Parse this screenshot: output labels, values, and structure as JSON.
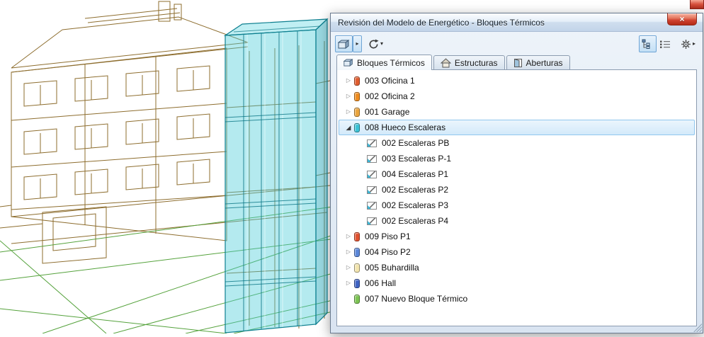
{
  "window": {
    "title": "Revisión del Modelo de Energético - Bloques Térmicos",
    "close_label": "×"
  },
  "glyphs": {
    "collapsed": "▷",
    "expanded": "◢",
    "dropdown": "▾",
    "flyout": "▸"
  },
  "toolbar": {
    "left_buttons": [
      "thermal-blocks-view",
      "flyout-arrow",
      "refresh"
    ],
    "right_buttons": [
      "tree-view",
      "list-view",
      "settings"
    ]
  },
  "tabs": [
    {
      "label": "Bloques Térmicos",
      "active": true
    },
    {
      "label": "Estructuras",
      "active": false
    },
    {
      "label": "Aberturas",
      "active": false
    }
  ],
  "colors": {
    "selection_fill": "#d2e9fa",
    "selection_border": "#90c6ee",
    "tower_highlight": "#4dccd8"
  },
  "tree": {
    "items": [
      {
        "label": "003 Oficina 1",
        "level": 0,
        "expandable": true,
        "expanded": false,
        "selected": false,
        "icon_color": "#e05c2e"
      },
      {
        "label": "002 Oficina 2",
        "level": 0,
        "expandable": true,
        "expanded": false,
        "selected": false,
        "icon_color": "#ee8b1e"
      },
      {
        "label": "001 Garage",
        "level": 0,
        "expandable": true,
        "expanded": false,
        "selected": false,
        "icon_color": "#eaa53e"
      },
      {
        "label": "008 Hueco Escaleras",
        "level": 0,
        "expandable": true,
        "expanded": true,
        "selected": true,
        "icon_color": "#3cc3d6"
      },
      {
        "label": "002 Escaleras PB",
        "level": 1,
        "expandable": false,
        "expanded": false,
        "selected": false
      },
      {
        "label": "003 Escaleras P-1",
        "level": 1,
        "expandable": false,
        "expanded": false,
        "selected": false
      },
      {
        "label": "004 Escaleras P1",
        "level": 1,
        "expandable": false,
        "expanded": false,
        "selected": false
      },
      {
        "label": "002 Escaleras P2",
        "level": 1,
        "expandable": false,
        "expanded": false,
        "selected": false
      },
      {
        "label": "002 Escaleras P3",
        "level": 1,
        "expandable": false,
        "expanded": false,
        "selected": false
      },
      {
        "label": "002 Escaleras P4",
        "level": 1,
        "expandable": false,
        "expanded": false,
        "selected": false
      },
      {
        "label": "009 Piso P1",
        "level": 0,
        "expandable": true,
        "expanded": false,
        "selected": false,
        "icon_color": "#e0512f"
      },
      {
        "label": "004 Piso P2",
        "level": 0,
        "expandable": true,
        "expanded": false,
        "selected": false,
        "icon_color": "#5a86d8"
      },
      {
        "label": "005 Buhardilla",
        "level": 0,
        "expandable": true,
        "expanded": false,
        "selected": false,
        "icon_color": "#f3e5ae"
      },
      {
        "label": "006 Hall",
        "level": 0,
        "expandable": true,
        "expanded": false,
        "selected": false,
        "icon_color": "#3e62c2"
      },
      {
        "label": "007 Nuevo Bloque Térmico",
        "level": 0,
        "expandable": false,
        "expanded": false,
        "selected": false,
        "icon_color": "#7cc452"
      }
    ]
  }
}
